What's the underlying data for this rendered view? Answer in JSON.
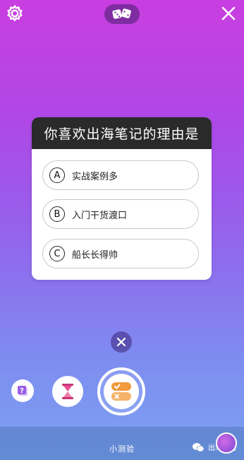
{
  "quiz": {
    "question": "你喜欢出海笔记的理由是",
    "options": [
      {
        "letter": "A",
        "text": "实战案例多"
      },
      {
        "letter": "B",
        "text": "入门干货渡口"
      },
      {
        "letter": "C",
        "text": "船长长得帅"
      }
    ]
  },
  "bottom": {
    "mode_label": "小测验",
    "watermark": "出海笔记"
  },
  "icons": {
    "top_left": "settings-gear-icon",
    "top_center": "dice-icon",
    "top_right": "close-icon",
    "tool_1": "question-sticker-icon",
    "tool_2": "hourglass-icon",
    "tool_3": "quiz-icon"
  },
  "colors": {
    "gradient_top": "#c93ee0",
    "gradient_bottom": "#7ba2ef",
    "quiz_title_bg": "#2a2a2a",
    "quiz_icon_orange": "#f19a3e"
  }
}
